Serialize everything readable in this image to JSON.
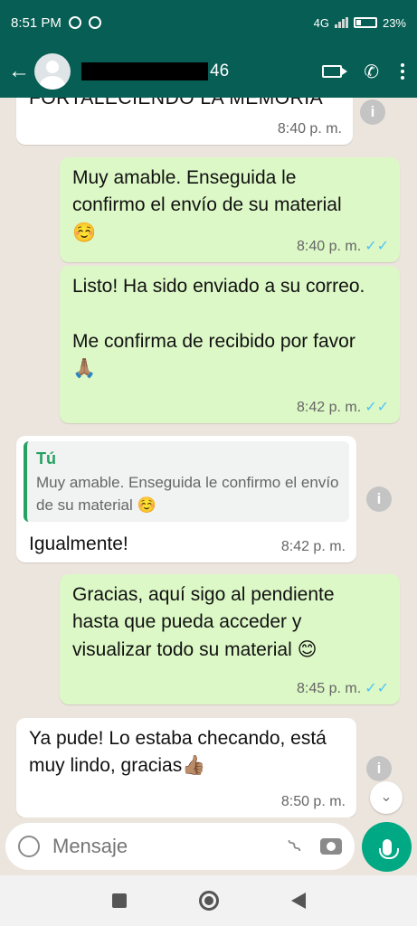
{
  "status_bar": {
    "time": "8:51 PM",
    "network": "4G",
    "battery": "23%"
  },
  "header": {
    "contact_suffix": "46"
  },
  "messages": [
    {
      "text": "FORTALECIENDO LA MEMORIA",
      "time": "8:40 p. m."
    },
    {
      "text": "Muy amable. Enseguida le confirmo el envío de su material ☺️",
      "time": "8:40 p. m."
    },
    {
      "text": "Listo! Ha sido enviado a su correo.\n\nMe confirma de recibido por favor 🙏🏽",
      "time": "8:42 p. m."
    },
    {
      "quote_author": "Tú",
      "quote_text": "Muy amable. Enseguida le confirmo el envío de su material ☺️",
      "text": "Igualmente!",
      "time": "8:42 p. m."
    },
    {
      "text": "Gracias, aquí sigo al pendiente hasta que pueda acceder y visualizar todo su material 😊",
      "time": "8:45 p. m."
    },
    {
      "text": "Ya pude! Lo estaba checando, está muy lindo, gracias👍🏽",
      "time": "8:50 p. m."
    }
  ],
  "composer": {
    "placeholder": "Mensaje"
  },
  "colors": {
    "header": "#075e54",
    "outgoing": "#dcf8c6",
    "incoming": "#ffffff",
    "read_ticks": "#4fc3f7",
    "mic_button": "#00a884"
  },
  "icons": [
    "back-arrow-icon",
    "video-call-icon",
    "phone-icon",
    "menu-icon",
    "info-icon",
    "read-ticks-icon",
    "emoji-icon",
    "attach-icon",
    "camera-icon",
    "mic-icon"
  ]
}
